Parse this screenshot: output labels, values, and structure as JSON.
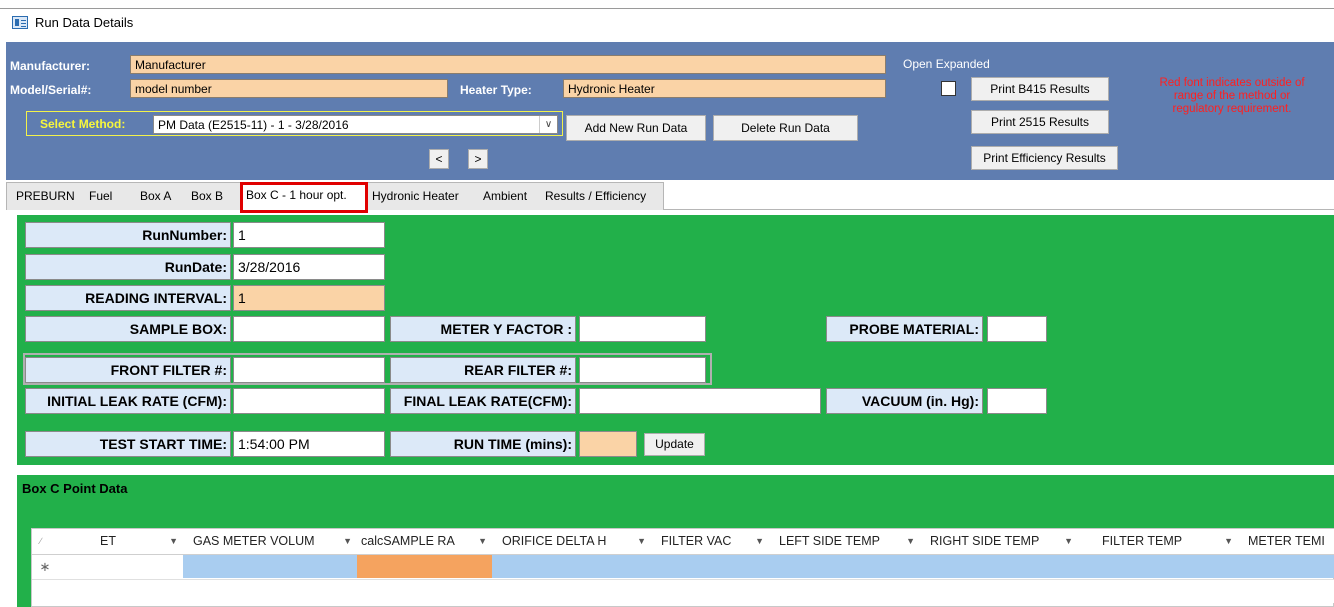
{
  "window": {
    "title": "Run Data Details"
  },
  "header": {
    "manufacturer_label": "Manufacturer:",
    "manufacturer_value": "Manufacturer",
    "model_label": "Model/Serial#:",
    "model_value": "model number",
    "heater_type_label": "Heater Type:",
    "heater_type_value": "Hydronic Heater",
    "select_method_label": "Select Method:",
    "select_method_value": "PM Data (E2515-11) - 1 - 3/28/2016",
    "open_expanded_label": "Open Expanded",
    "add_run_label": "Add New Run Data",
    "delete_run_label": "Delete Run Data",
    "print_b415_label": "Print B415 Results",
    "print_2515_label": "Print 2515 Results",
    "print_efficiency_label": "Print Efficiency Results",
    "prev_label": "<",
    "next_label": ">",
    "red_note": "Red font indicates outside of range of the method or regulatory requirement."
  },
  "tabs": [
    {
      "label": "PREBURN"
    },
    {
      "label": "Fuel"
    },
    {
      "label": "Box A"
    },
    {
      "label": "Box B"
    },
    {
      "label": "Box C - 1 hour opt."
    },
    {
      "label": "Hydronic Heater"
    },
    {
      "label": "Ambient"
    },
    {
      "label": "Results / Efficiency"
    }
  ],
  "form": {
    "run_number_label": "RunNumber:",
    "run_number_value": "1",
    "run_date_label": "RunDate:",
    "run_date_value": "3/28/2016",
    "reading_interval_label": "READING INTERVAL:",
    "reading_interval_value": "1",
    "sample_box_label": "SAMPLE BOX:",
    "sample_box_value": "",
    "meter_y_label": "METER Y FACTOR :",
    "meter_y_value": "",
    "probe_material_label": "PROBE MATERIAL:",
    "probe_material_value": "",
    "front_filter_label": "FRONT FILTER #:",
    "front_filter_value": "",
    "rear_filter_label": "REAR FILTER #:",
    "rear_filter_value": "",
    "initial_leak_label": "INITIAL LEAK RATE (CFM):",
    "initial_leak_value": "",
    "final_leak_label": "FINAL LEAK RATE(CFM):",
    "final_leak_value": "",
    "vacuum_label": "VACUUM (in. Hg):",
    "vacuum_value": "",
    "test_start_label": "TEST START TIME:",
    "test_start_value": "1:54:00 PM",
    "run_time_label": "RUN TIME (mins):",
    "run_time_value": "",
    "update_label": "Update"
  },
  "subform": {
    "title": "Box C Point Data",
    "new_row_marker": "∗",
    "columns": [
      "ET",
      "GAS METER VOLUM",
      "calcSAMPLE RA",
      "ORIFICE DELTA H",
      "FILTER VAC",
      "LEFT SIDE TEMP",
      "RIGHT SIDE TEMP",
      "FILTER TEMP",
      "METER TEMI"
    ]
  },
  "colors": {
    "header_bg": "#5f7db0",
    "form_bg": "#22b04a",
    "peach_field": "#fad3a6",
    "label_bg": "#dce9f8",
    "active_tab_outline": "#e00000",
    "note_red": "#ff2020"
  }
}
